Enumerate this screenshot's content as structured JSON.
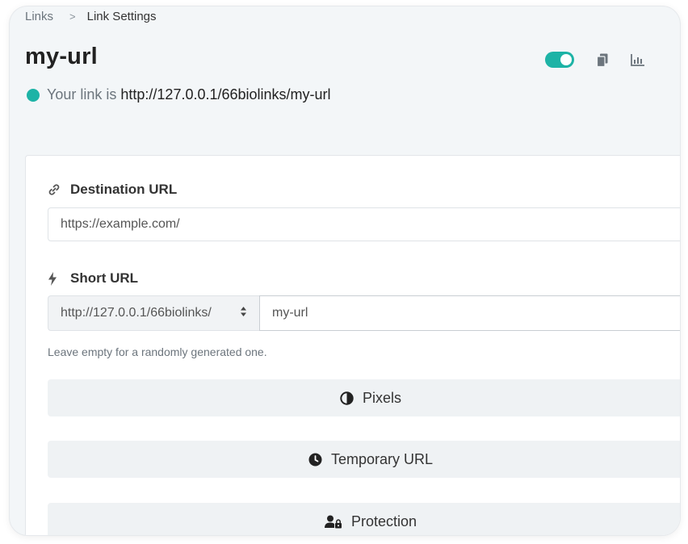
{
  "breadcrumb": {
    "parent": "Links",
    "separator": ">",
    "current": "Link Settings"
  },
  "page": {
    "title": "my-url"
  },
  "toolbar": {
    "toggle_on": true,
    "accent_color": "#1db3a6",
    "icons": [
      "toggle-switch",
      "copy-icon",
      "statistics-icon"
    ]
  },
  "status": {
    "prefix": "Your link is",
    "url": "http://127.0.0.1/66biolinks/my-url",
    "dot_color": "#1db3a6"
  },
  "form": {
    "destination": {
      "label": "Destination URL",
      "icon": "link-icon",
      "value": "https://example.com/"
    },
    "short_url": {
      "label": "Short URL",
      "icon": "bolt-icon",
      "domain": "http://127.0.0.1/66biolinks/",
      "value": "my-url",
      "help": "Leave empty for a randomly generated one."
    },
    "sections": [
      {
        "label": "Pixels",
        "icon": "half-circle-icon"
      },
      {
        "label": "Temporary URL",
        "icon": "clock-icon"
      },
      {
        "label": "Protection",
        "icon": "user-lock-icon"
      }
    ]
  }
}
